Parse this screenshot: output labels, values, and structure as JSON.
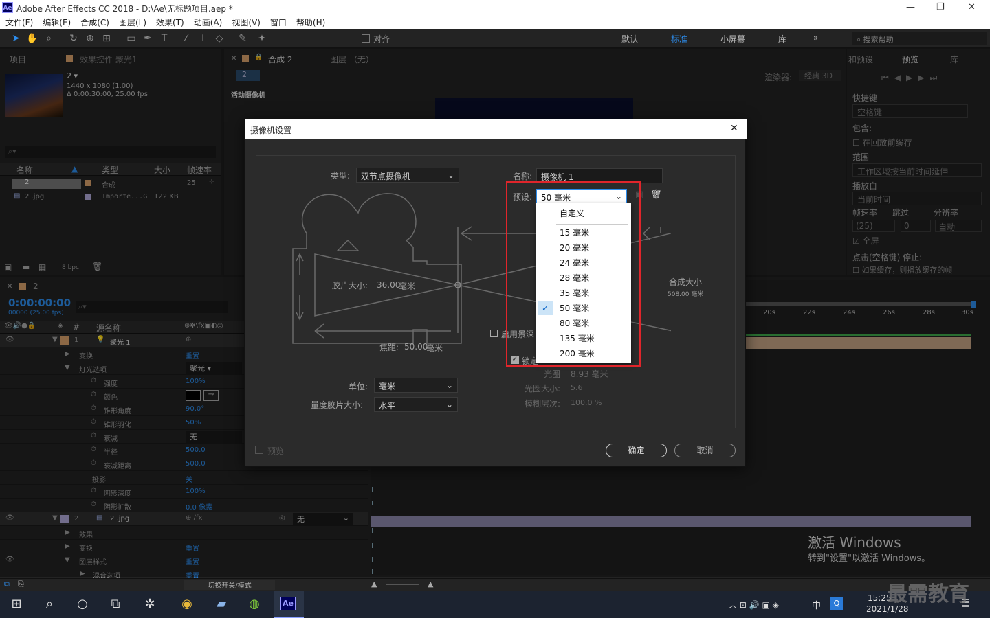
{
  "app": {
    "title": "Adobe After Effects CC 2018 - D:\\Ae\\无标题项目.aep *",
    "logo": "Ae"
  },
  "window_controls": [
    "—",
    "❐",
    "✕"
  ],
  "menu": [
    "文件(F)",
    "编辑(E)",
    "合成(C)",
    "图层(L)",
    "效果(T)",
    "动画(A)",
    "视图(V)",
    "窗口",
    "帮助(H)"
  ],
  "toolbar": {
    "align_label": "对齐",
    "workspaces": [
      "默认",
      "标准",
      "小屏幕",
      "库"
    ],
    "search_placeholder": "搜索帮助"
  },
  "project": {
    "tab_project": "项目",
    "tab_effects": "效果控件 聚光1",
    "comp_name": "2 ▾",
    "comp_size": "1440 x 1080 (1.00)",
    "comp_duration": "Δ 0:00:30:00, 25.00 fps",
    "columns": [
      "名称",
      "类型",
      "大小",
      "帧速率"
    ],
    "items": [
      {
        "name": "2",
        "type": "合成",
        "size": "",
        "fps": "25"
      },
      {
        "name": "2 .jpg",
        "type": "Importe...G",
        "size": "122 KB",
        "fps": ""
      }
    ],
    "bpc": "8 bpc"
  },
  "viewer": {
    "tab": "合成 2",
    "tab_layer": "图层 （无）",
    "comp_chip": "2",
    "label": "活动摄像机",
    "renderer_label": "渲染器:",
    "renderer": "经典 3D"
  },
  "right_panel": {
    "tab_effects": "和预设",
    "tab_preview": "预览",
    "tab_lib": "库",
    "shortcut_label": "快捷键",
    "shortcut": "空格键",
    "include": "包含:",
    "cache_before": "在回放前缓存",
    "range_label": "范围",
    "range": "工作区域按当前时间延伸",
    "playfrom_label": "播放自",
    "playfrom": "当前时间",
    "fps_label": "帧速率",
    "skip_label": "跳过",
    "res_label": "分辨率",
    "fps": "(25)",
    "skip": "0",
    "res": "自动",
    "fullscreen": "全屏",
    "stop_label": "点击(空格键) 停止:",
    "stop_opt": "如果缓存，则播放缓存的帧"
  },
  "timeline": {
    "tab": "2",
    "timecode": "0:00:00:00",
    "timecode_sub": "00000 (25.00 fps)",
    "col_source": "源名称",
    "ticks": [
      "20s",
      "22s",
      "24s",
      "26s",
      "28s",
      "30s"
    ],
    "toggle_label": "切换开关/模式"
  },
  "layers": [
    {
      "num": "1",
      "name": "聚光 1",
      "kind": "light"
    },
    {
      "label": "变换",
      "value": "重置",
      "indent": 1
    },
    {
      "label": "灯光选项",
      "value": "聚光",
      "indent": 1
    },
    {
      "label": "强度",
      "value": "100%",
      "indent": 2
    },
    {
      "label": "颜色",
      "value": "",
      "indent": 2
    },
    {
      "label": "锥形角度",
      "value": "90.0°",
      "indent": 2
    },
    {
      "label": "锥形羽化",
      "value": "50%",
      "indent": 2
    },
    {
      "label": "衰减",
      "value": "无",
      "indent": 2
    },
    {
      "label": "半径",
      "value": "500.0",
      "indent": 2
    },
    {
      "label": "衰减距离",
      "value": "500.0",
      "indent": 2
    },
    {
      "label": "投影",
      "value": "关",
      "indent": 2
    },
    {
      "label": "阴影深度",
      "value": "100%",
      "indent": 2
    },
    {
      "label": "阴影扩散",
      "value": "0.0 像素",
      "indent": 2
    },
    {
      "num": "2",
      "name": "2 .jpg",
      "kind": "image",
      "mode": "无"
    },
    {
      "label": "效果",
      "value": "",
      "indent": 1
    },
    {
      "label": "变换",
      "value": "重置",
      "indent": 1
    },
    {
      "label": "图层样式",
      "value": "重置",
      "indent": 1
    },
    {
      "label": "混合选项",
      "value": "重置",
      "indent": 2
    }
  ],
  "dialog": {
    "title": "摄像机设置",
    "close": "✕",
    "type_label": "类型:",
    "type_value": "双节点摄像机",
    "name_label": "名称:",
    "name_value": "摄像机 1",
    "preset_label": "预设:",
    "preset_value": "50 毫米",
    "film_size": "胶片大小:",
    "film_value": "36.00",
    "mm": "毫米",
    "comp_size": "合成大小",
    "comp_size_value": "508.00 毫米",
    "focal_label": "焦距:",
    "focal_value": "50.00",
    "dof": "启用景深",
    "lock": "锁定",
    "aperture": "光圈",
    "aperture_value": "8.93 毫米",
    "fstop": "光圈大小:",
    "fstop_value": "5.6",
    "blur": "模糊层次:",
    "blur_value": "100.0 %",
    "units_label": "单位:",
    "units_value": "毫米",
    "measure_label": "量度胶片大小:",
    "measure_value": "水平",
    "preview": "预览",
    "ok": "确定",
    "cancel": "取消"
  },
  "preset_options": [
    "自定义",
    "15 毫米",
    "20 毫米",
    "24 毫米",
    "28 毫米",
    "35 毫米",
    "50 毫米",
    "80 毫米",
    "135 毫米",
    "200 毫米"
  ],
  "watermark": {
    "line1": "激活 Windows",
    "line2": "转到\"设置\"以激活 Windows。",
    "brand": "最需教育"
  },
  "taskbar": {
    "time": "15:25",
    "date": "2021/1/28",
    "ime": "中",
    "app_ae": "Ae"
  },
  "colors": {
    "accent": "#2d8ceb",
    "highlight": "#e0252b"
  }
}
